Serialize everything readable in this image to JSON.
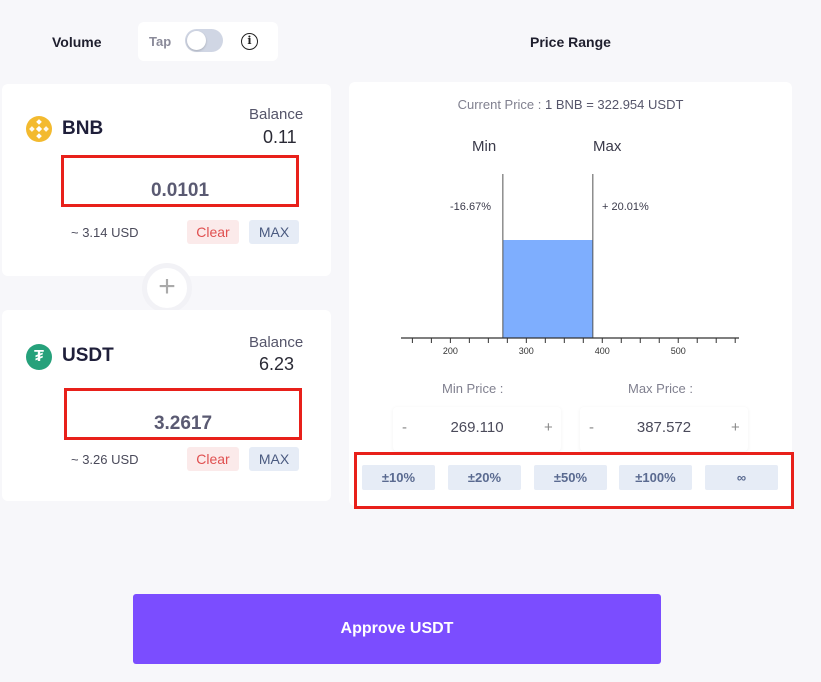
{
  "header": {
    "volume_title": "Volume",
    "tap_label": "Tap",
    "info_glyph": "i",
    "price_range_title": "Price Range"
  },
  "toggle": {
    "on": false
  },
  "tokens": [
    {
      "symbol": "BNB",
      "icon": "bnb-coin-icon",
      "icon_color": "#f3ba2f",
      "balance_label": "Balance",
      "balance": "0.11",
      "amount": "0.0101",
      "usd": "~ 3.14 USD",
      "clear_label": "Clear",
      "max_label": "MAX"
    },
    {
      "symbol": "USDT",
      "icon": "tether-coin-icon",
      "icon_color": "#26a17b",
      "icon_glyph": "₮",
      "balance_label": "Balance",
      "balance": "6.23",
      "amount": "3.2617",
      "usd": "~ 3.26 USD",
      "clear_label": "Clear",
      "max_label": "MAX"
    }
  ],
  "plus_glyph": "+",
  "price_range": {
    "current_price_label": "Current Price :",
    "current_price_value": "1 BNB = 322.954 USDT",
    "min_label": "Min",
    "max_label": "Max",
    "min_pct": "-16.67%",
    "max_pct": "+ 20.01%",
    "min_price_label": "Min Price :",
    "max_price_label": "Max Price :",
    "min_price": "269.110",
    "max_price": "387.572",
    "minus_glyph": "-",
    "plus_glyph": "+",
    "presets": [
      "±10%",
      "±20%",
      "±50%",
      "±100%",
      "∞"
    ]
  },
  "chart_data": {
    "type": "bar",
    "x_ticks": [
      "200",
      "300",
      "400",
      "500"
    ],
    "x_tick_values": [
      200,
      300,
      400,
      500
    ],
    "xlim": [
      135,
      580
    ],
    "range": {
      "min": 269.11,
      "max": 387.572
    },
    "bar_color": "#7eaefe"
  },
  "approve_label": "Approve USDT",
  "colors": {
    "accent": "#7b4dff",
    "highlight": "#e8201a"
  }
}
